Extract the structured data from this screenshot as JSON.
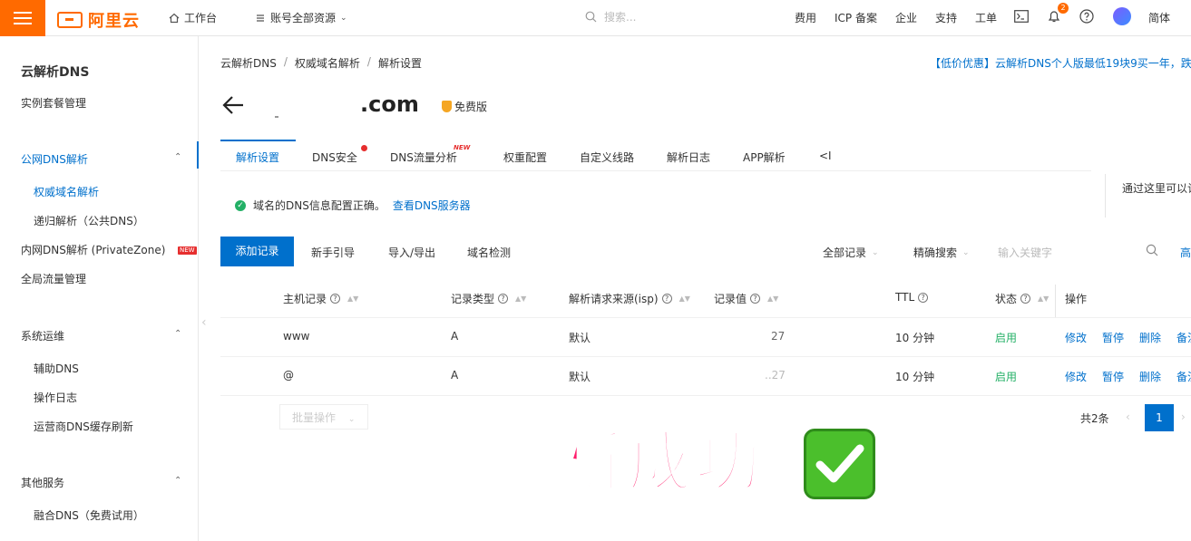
{
  "topbar": {
    "logo": "阿里云",
    "workbench": "工作台",
    "resources": "账号全部资源",
    "search_placeholder": "搜索...",
    "fees": "费用",
    "icp": "ICP 备案",
    "enterprise": "企业",
    "support": "支持",
    "ticket": "工单",
    "notification_count": "2",
    "language": "简体"
  },
  "sidebar": {
    "title": "云解析DNS",
    "instance_mgmt": "实例套餐管理",
    "public_dns": "公网DNS解析",
    "authoritative": "权威域名解析",
    "recursive": "递归解析（公共DNS）",
    "private_dns": "内网DNS解析 (PrivateZone)",
    "new_tag": "NEW",
    "gtm": "全局流量管理",
    "ops": "系统运维",
    "aux_dns": "辅助DNS",
    "op_log": "操作日志",
    "isp_refresh": "运营商DNS缓存刷新",
    "other": "其他服务",
    "fusion_dns": "融合DNS（免费试用）"
  },
  "breadcrumb": [
    "云解析DNS",
    "权威域名解析",
    "解析设置"
  ],
  "promo": "【低价优惠】云解析DNS个人版最低19块9买一年，跌",
  "header": {
    "domain": ".com",
    "edition": "免费版"
  },
  "tabs": [
    "解析设置",
    "DNS安全",
    "DNS流量分析",
    "权重配置",
    "自定义线路",
    "解析日志",
    "APP解析",
    "<I"
  ],
  "tab_new": "NEW",
  "status": {
    "message": "域名的DNS信息配置正确。",
    "link": "查看DNS服务器",
    "right_hint": "通过这里可以让"
  },
  "toolbar": {
    "add": "添加记录",
    "guide": "新手引导",
    "import_export": "导入/导出",
    "check": "域名检测",
    "all_records": "全部记录",
    "exact_search": "精确搜索",
    "keyword_placeholder": "输入关键字",
    "advanced": "高"
  },
  "table": {
    "headers": {
      "host": "主机记录",
      "type": "记录类型",
      "isp": "解析请求来源(isp)",
      "value": "记录值",
      "ttl": "TTL",
      "status": "状态",
      "ops": "操作"
    },
    "rows": [
      {
        "host": "www",
        "type": "A",
        "isp": "默认",
        "value": "27",
        "ttl": "10 分钟",
        "status": "启用",
        "edit": "修改",
        "pause": "暂停",
        "delete": "删除",
        "remark": "备注"
      },
      {
        "host": "@",
        "type": "A",
        "isp": "默认",
        "value": "..27",
        "ttl": "10 分钟",
        "status": "启用",
        "edit": "修改",
        "pause": "暂停",
        "delete": "删除",
        "remark": "备注"
      }
    ]
  },
  "footer": {
    "batch": "批量操作",
    "total": "共2条",
    "page": "1"
  },
  "overlay": {
    "success_text": "解析成功"
  }
}
